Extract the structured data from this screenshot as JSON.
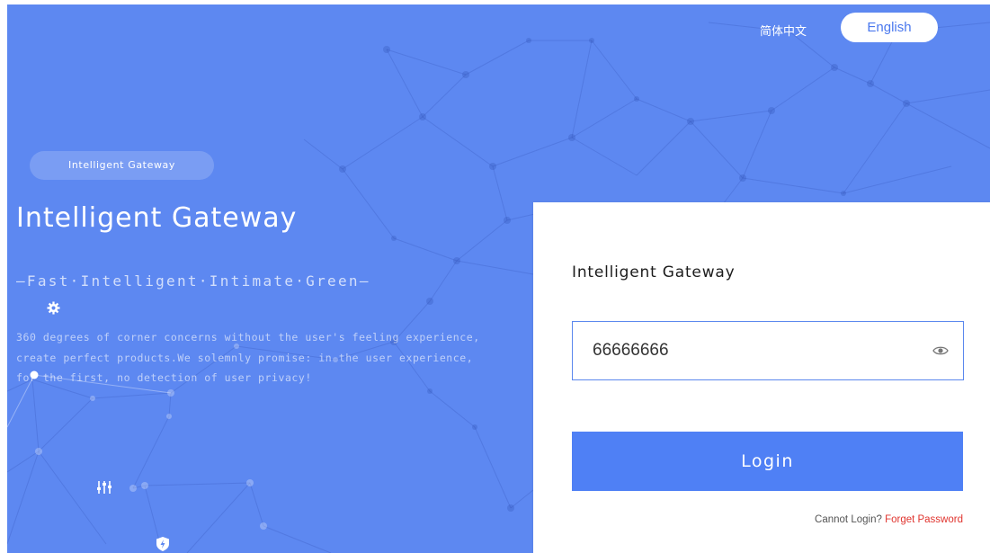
{
  "header": {
    "lang_chinese": "简体中文",
    "lang_english": "English"
  },
  "hero": {
    "tag": "Intelligent Gateway",
    "title": "Intelligent Gateway",
    "slogan": "—Fast·Intelligent·Intimate·Green—",
    "description": "360 degrees of corner concerns without the user's feeling experience, create perfect products.We solemnly promise: in the user experience, for the first, no detection of user privacy!",
    "icons": [
      "gear-icon",
      "sliders-icon",
      "shield-icon"
    ]
  },
  "login": {
    "title": "Intelligent Gateway",
    "password_value": "66666666",
    "password_visible_icon": "eye-icon",
    "button_label": "Login",
    "help_prefix": "Cannot Login?",
    "forget_link": "Forget Password"
  },
  "colors": {
    "background": "#5d88f1",
    "accent": "#4f80f5",
    "link": "#e0342e"
  }
}
